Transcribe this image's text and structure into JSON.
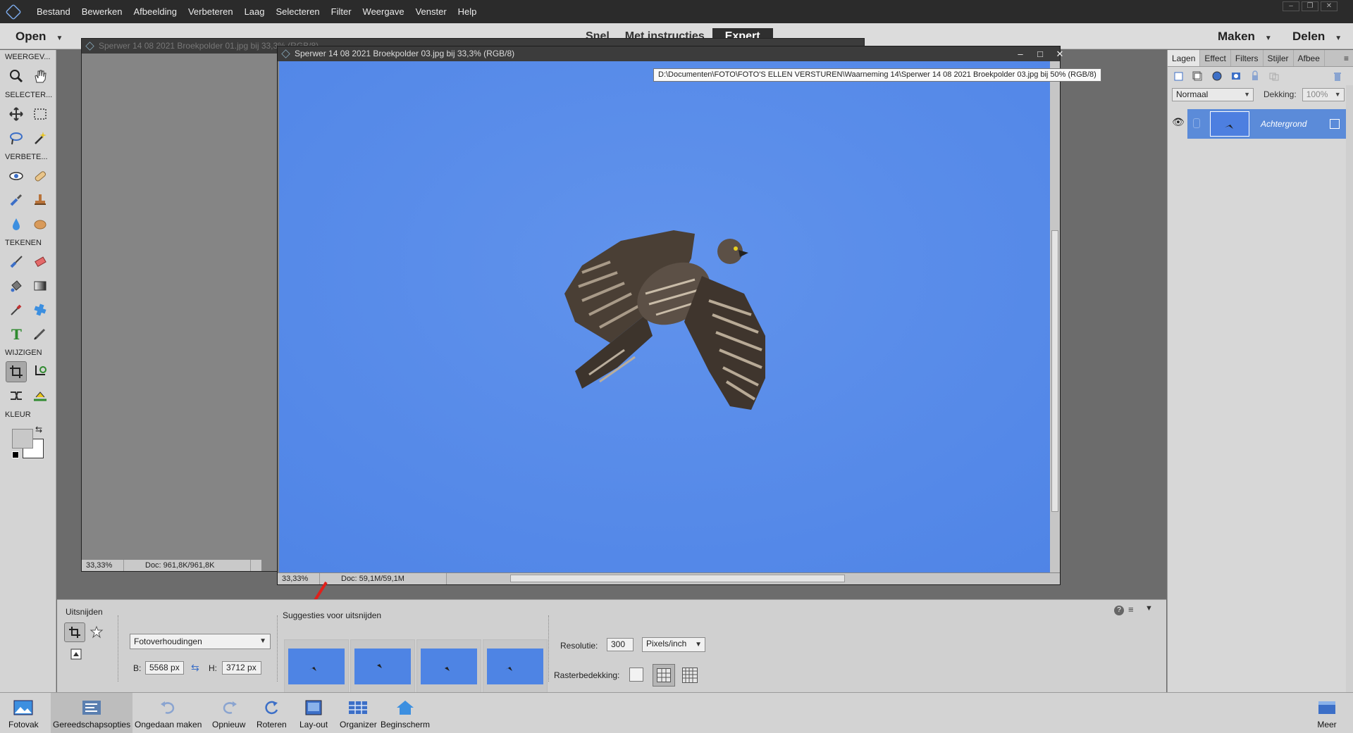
{
  "menubar": {
    "items": [
      "Bestand",
      "Bewerken",
      "Afbeelding",
      "Verbeteren",
      "Laag",
      "Selecteren",
      "Filter",
      "Weergave",
      "Venster",
      "Help"
    ]
  },
  "topbar": {
    "open_label": "Open",
    "modes": [
      "Snel",
      "Met instructies",
      "Expert"
    ],
    "active_mode": "Expert",
    "maken_label": "Maken",
    "delen_label": "Delen"
  },
  "toolbox": {
    "sections": {
      "weergeven": "WEERGEV...",
      "selecteren": "SELECTER...",
      "verbeteren": "VERBETE...",
      "tekenen": "TEKENEN",
      "wijzigen": "WIJZIGEN",
      "kleur": "KLEUR"
    }
  },
  "doc_back": {
    "title": "Sperwer 14 08 2021 Broekpolder 01.jpg bij 33,3% (RGB/8)",
    "zoom": "33,33%",
    "docsize": "Doc: 961,8K/961,8K"
  },
  "doc_front": {
    "title": "Sperwer 14 08 2021 Broekpolder 03.jpg bij 33,3% (RGB/8)",
    "zoom": "33,33%",
    "docsize": "Doc: 59,1M/59,1M"
  },
  "tooltip": {
    "text": "D:\\Documenten\\FOTO\\FOTO'S ELLEN VERSTUREN\\Waarneming 14\\Sperwer 14 08 2021 Broekpolder 03.jpg bij 50% (RGB/8)"
  },
  "layers_panel": {
    "tabs": [
      "Lagen",
      "Effect",
      "Filters",
      "Stijler",
      "Afbee"
    ],
    "active_tab": "Lagen",
    "blend_mode": "Normaal",
    "opacity_label": "Dekking:",
    "opacity_value": "100%",
    "layer_name": "Achtergrond"
  },
  "tool_options": {
    "title": "Uitsnijden",
    "aspect_preset": "Fotoverhoudingen",
    "width_label": "B:",
    "width_value": "5568 px",
    "height_label": "H:",
    "height_value": "3712 px",
    "suggestions_label": "Suggesties voor uitsnijden",
    "resolution_label": "Resolutie:",
    "resolution_value": "300",
    "resolution_unit": "Pixels/inch",
    "grid_label": "Rasterbedekking:"
  },
  "taskbar": {
    "fotovak": "Fotovak",
    "gereedschapsopties": "Gereedschapsopties",
    "ongedaan": "Ongedaan maken",
    "opnieuw": "Opnieuw",
    "roteren": "Roteren",
    "layout": "Lay-out",
    "organizer": "Organizer",
    "beginscherm": "Beginscherm",
    "meer": "Meer"
  },
  "colors": {
    "sky": "#5b8ee9",
    "menubar": "#2b2b2b",
    "annotation_arrow": "#e0201b",
    "layer_selected": "#5b8bd9"
  }
}
